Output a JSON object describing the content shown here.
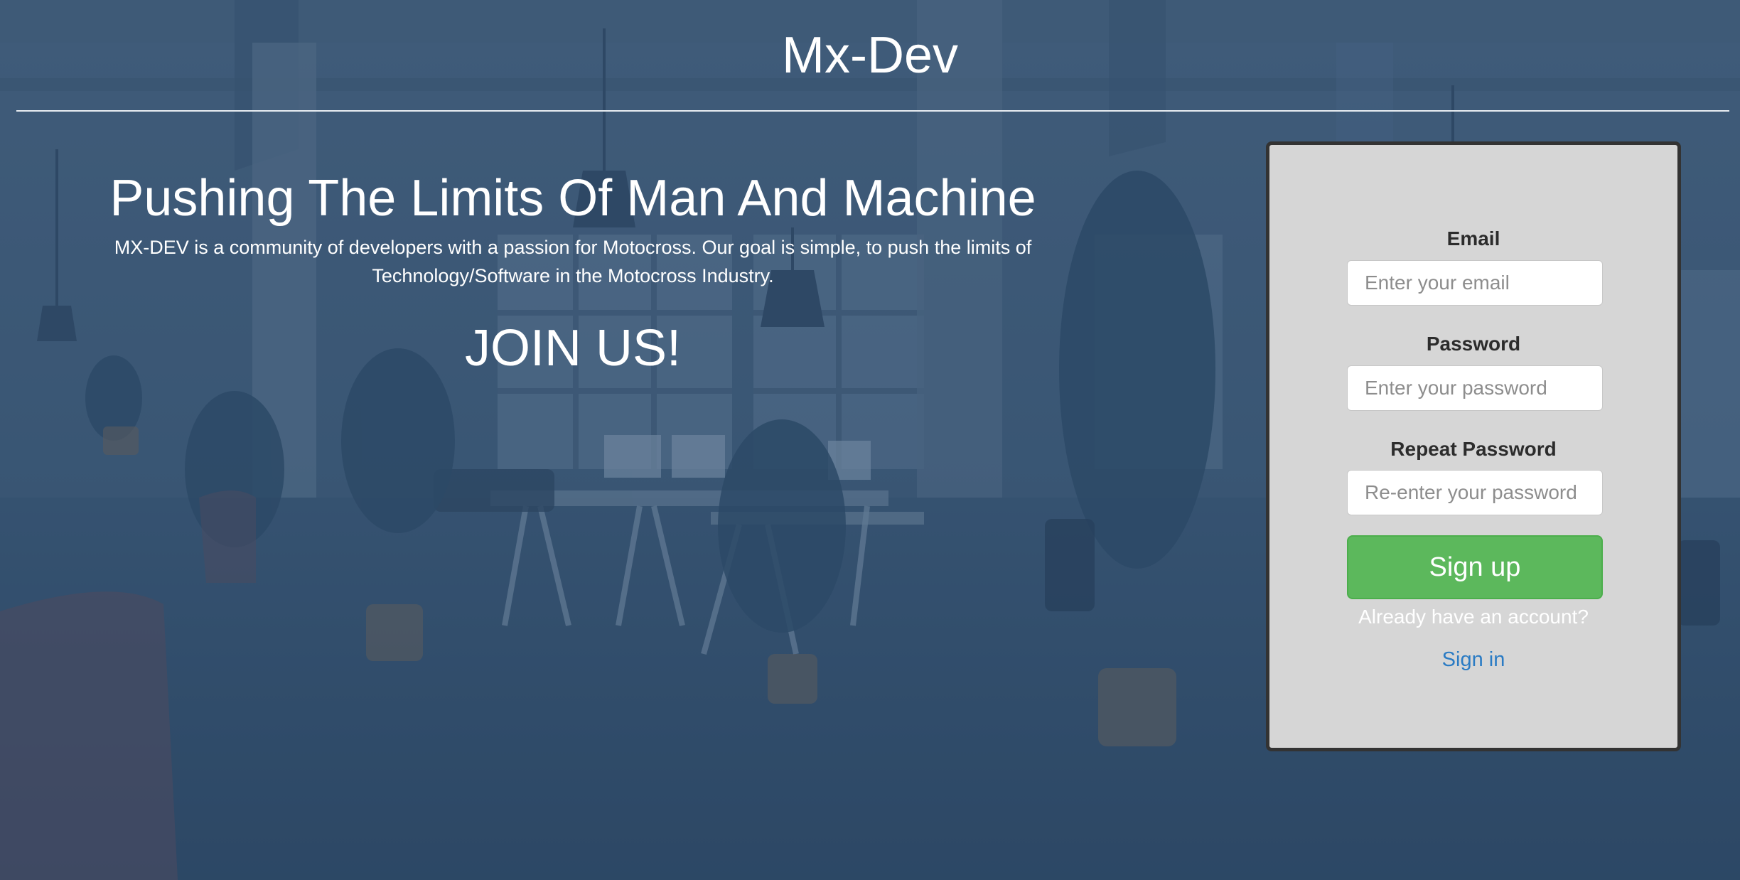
{
  "site": {
    "title": "Mx-Dev"
  },
  "hero": {
    "heading": "Pushing The Limits Of Man And Machine",
    "description": "MX-DEV is a community of developers with a passion for Motocross. Our goal is simple, to push the limits of Technology/Software in the Motocross Industry.",
    "cta": "JOIN US!"
  },
  "signup_form": {
    "email_label": "Email",
    "email_placeholder": "Enter your email",
    "password_label": "Password",
    "password_placeholder": "Enter your password",
    "repeat_password_label": "Repeat Password",
    "repeat_password_placeholder": "Re-enter your password",
    "submit_label": "Sign up",
    "account_prompt": "Already have an account?",
    "signin_label": "Sign in"
  },
  "colors": {
    "background_overlay": "#3e5874",
    "card_background": "#d6d6d6",
    "card_border": "#333333",
    "primary_button": "#5cb85c",
    "link": "#2a7bc4"
  }
}
